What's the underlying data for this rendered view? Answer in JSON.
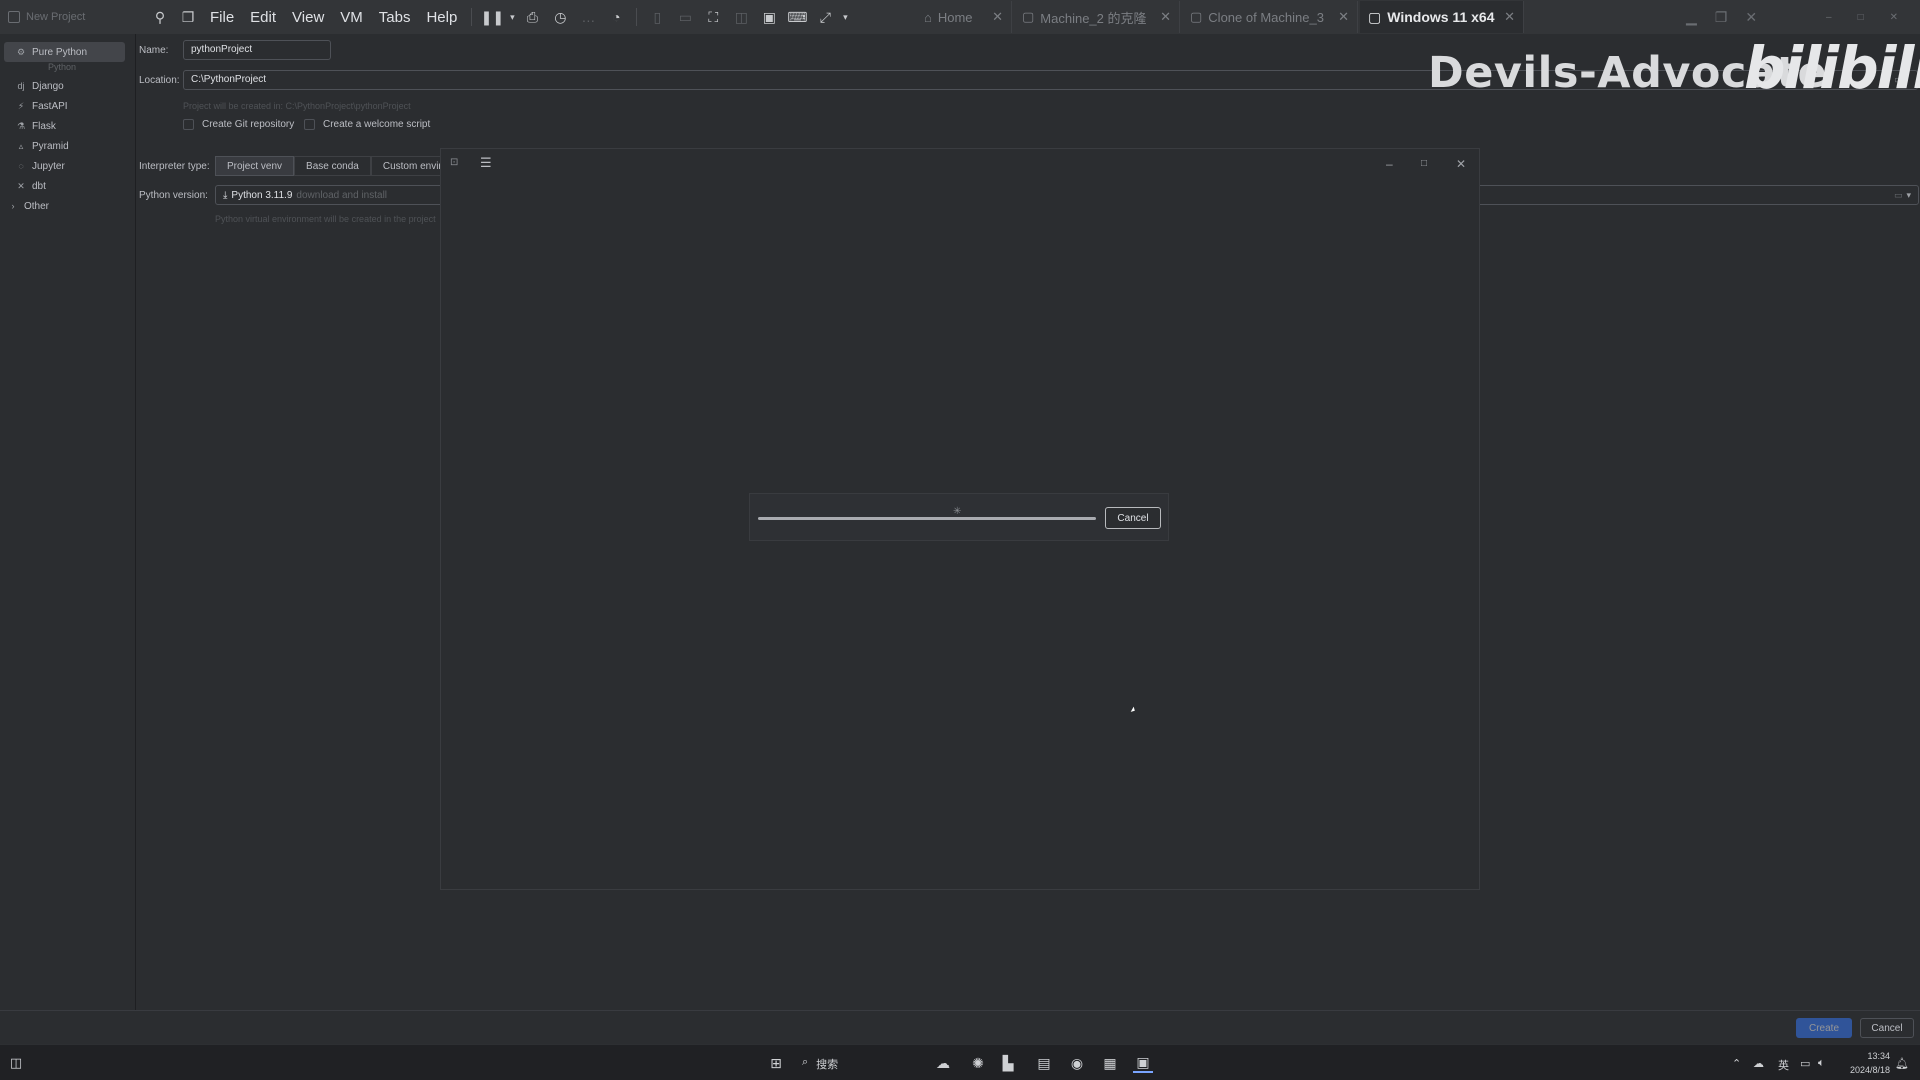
{
  "vmware": {
    "window_title": "New Project",
    "menu": [
      "File",
      "Edit",
      "View",
      "VM",
      "Tabs",
      "Help"
    ],
    "tabs": [
      {
        "label": "Home"
      },
      {
        "label": "Machine_2 的克隆"
      },
      {
        "label": "Clone of Machine_3"
      },
      {
        "label": "Windows 11 x64"
      }
    ]
  },
  "watermark": {
    "text": "Devils-Advocate",
    "brand": "bilibili"
  },
  "sidebar": {
    "items": [
      {
        "label": "Pure Python",
        "icon": "python-icon",
        "selected": true
      },
      {
        "label": "Django",
        "icon": "django-icon"
      },
      {
        "label": "FastAPI",
        "icon": "fastapi-icon"
      },
      {
        "label": "Flask",
        "icon": "flask-icon"
      },
      {
        "label": "Pyramid",
        "icon": "pyramid-icon"
      },
      {
        "label": "Jupyter",
        "icon": "jupyter-icon"
      },
      {
        "label": "dbt",
        "icon": "dbt-icon"
      },
      {
        "label": "Other",
        "icon": "chevron-right-icon"
      }
    ],
    "sub_label": "Python"
  },
  "form": {
    "name_label": "Name:",
    "name_value": "pythonProject",
    "location_label": "Location:",
    "location_value": "C:\\PythonProject",
    "location_hint": "Project will be created in: C:\\PythonProject\\pythonProject",
    "git_label": "Create Git repository",
    "welcome_label": "Create a welcome script",
    "interpreter_label": "Interpreter type:",
    "interpreter_options": [
      "Project venv",
      "Base conda",
      "Custom enviro"
    ],
    "python_version_label": "Python version:",
    "python_version_value": "Python 3.11.9",
    "python_version_note": "download and install",
    "venv_hint": "Python virtual environment will be created in the project"
  },
  "progress_dialog": {
    "cancel_label": "Cancel"
  },
  "footer": {
    "create_label": "Create",
    "cancel_label": "Cancel"
  },
  "taskbar": {
    "search_label": "搜索",
    "time": "13:34",
    "date": "2024/8/18",
    "ime": "英"
  },
  "colors": {
    "accent": "#3574f0",
    "background": "#2b2d30"
  }
}
